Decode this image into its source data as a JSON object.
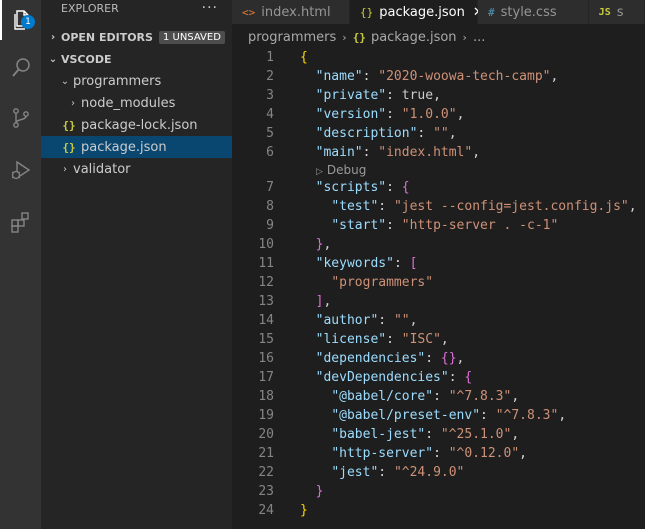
{
  "activity": {
    "items": [
      {
        "name": "explorer-icon",
        "badge": "1"
      },
      {
        "name": "search-icon"
      },
      {
        "name": "source-control-icon"
      },
      {
        "name": "run-debug-icon"
      },
      {
        "name": "extensions-icon"
      }
    ]
  },
  "explorer": {
    "title": "EXPLORER",
    "more": "···",
    "open_editors": "OPEN EDITORS",
    "unsaved": "1 UNSAVED",
    "workspace": "VSCODE",
    "tree": [
      {
        "label": "programmers",
        "type": "folder-open"
      },
      {
        "label": "node_modules",
        "type": "folder"
      },
      {
        "label": "package-lock.json",
        "type": "json"
      },
      {
        "label": "package.json",
        "type": "json",
        "selected": true
      },
      {
        "label": "validator",
        "type": "folder"
      }
    ]
  },
  "tabs": [
    {
      "icon": "<>",
      "label": "index.html",
      "state": "modified",
      "color": "#e37933"
    },
    {
      "icon": "{}",
      "label": "package.json",
      "state": "active",
      "color": "#cbcb41"
    },
    {
      "icon": "#",
      "label": "style.css",
      "state": "normal",
      "color": "#519aba"
    },
    {
      "icon": "JS",
      "label": "s",
      "state": "normal",
      "color": "#cbcb41"
    }
  ],
  "breadcrumb": {
    "folder": "programmers",
    "file": "package.json",
    "more": "..."
  },
  "codelens": {
    "label": "Debug",
    "after_line": 6
  },
  "code_lines": [
    "{",
    "  \"name\": \"2020-woowa-tech-camp\",",
    "  \"private\": true,",
    "  \"version\": \"1.0.0\",",
    "  \"description\": \"\",",
    "  \"main\": \"index.html\",",
    "  \"scripts\": {",
    "    \"test\": \"jest --config=jest.config.js\",",
    "    \"start\": \"http-server . -c-1\"",
    "  },",
    "  \"keywords\": [",
    "    \"programmers\"",
    "  ],",
    "  \"author\": \"\",",
    "  \"license\": \"ISC\",",
    "  \"dependencies\": {},",
    "  \"devDependencies\": {",
    "    \"@babel/core\": \"^7.8.3\",",
    "    \"@babel/preset-env\": \"^7.8.3\",",
    "    \"babel-jest\": \"^25.1.0\",",
    "    \"http-server\": \"^0.12.0\",",
    "    \"jest\": \"^24.9.0\"",
    "  }",
    "}"
  ],
  "colors": {
    "key": "#9cdcfe",
    "string": "#ce9178",
    "keyword": "#569cd6",
    "punct": "#d4d4d4",
    "bracket1": "#ffd700",
    "bracket2": "#da70d6",
    "accent": "#007acc",
    "selection": "#094771"
  }
}
